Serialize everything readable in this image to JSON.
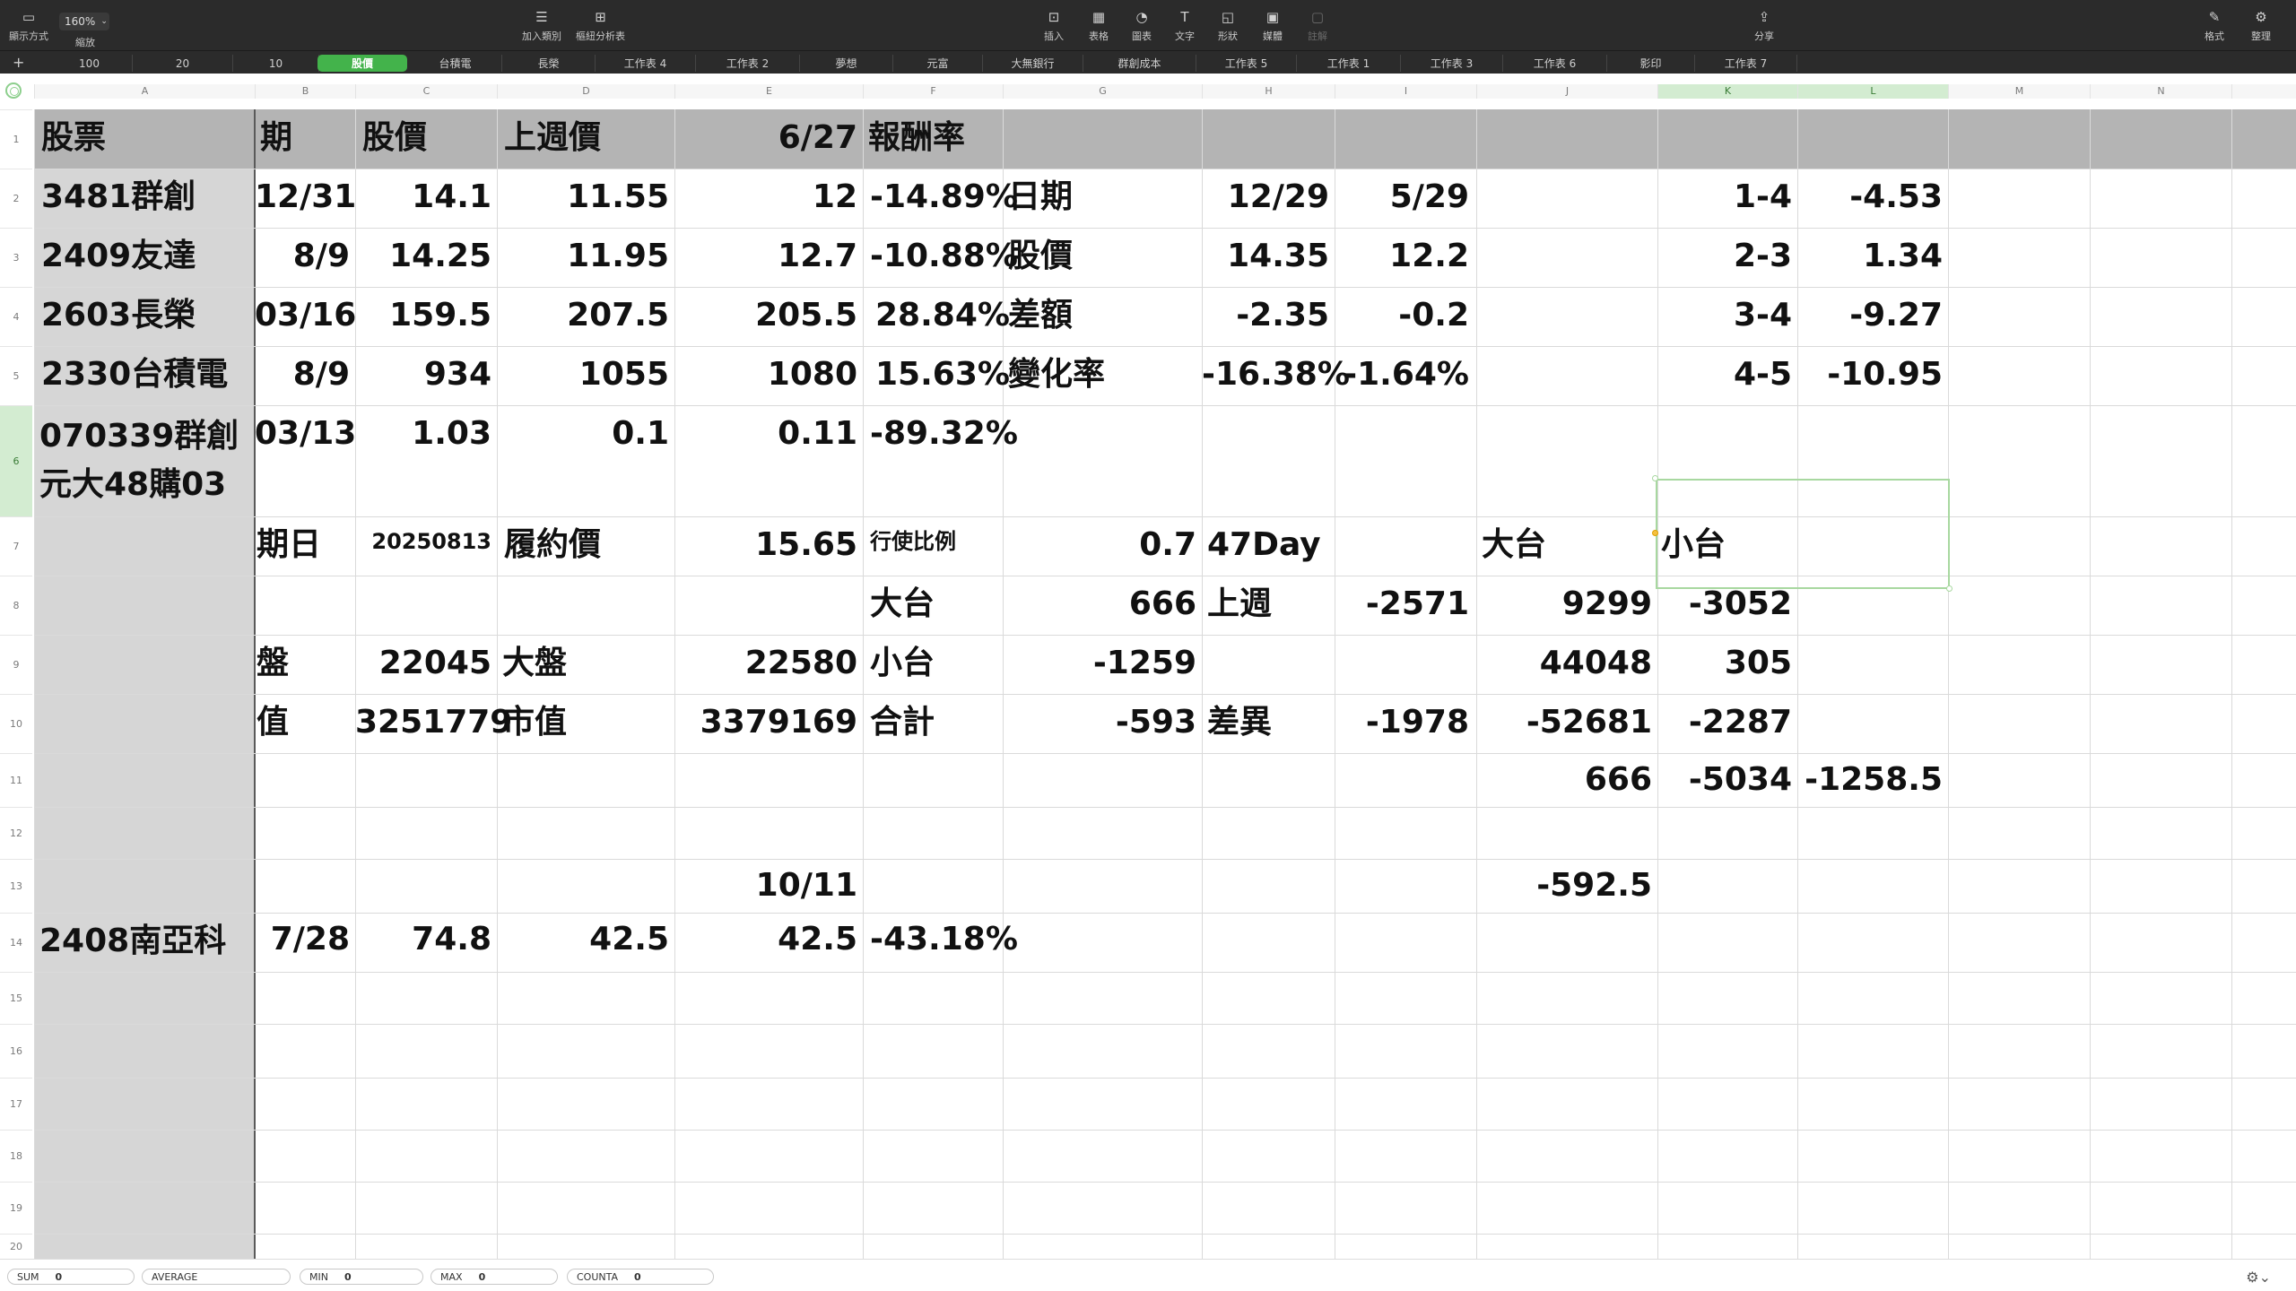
{
  "toolbar": {
    "view_label": "顯示方式",
    "zoom_value": "160%",
    "zoom_label": "縮放",
    "add_category": "加入類別",
    "pivot": "樞紐分析表",
    "insert": "插入",
    "table": "表格",
    "chart": "圖表",
    "text": "文字",
    "shape": "形狀",
    "media": "媒體",
    "comment": "註解",
    "share": "分享",
    "format": "格式",
    "organize": "整理"
  },
  "tabs": [
    "100",
    "20",
    "10",
    "股價",
    "台積電",
    "長榮",
    "工作表 4",
    "工作表 2",
    "夢想",
    "元富",
    "大無銀行",
    "群創成本",
    "工作表 5",
    "工作表 1",
    "工作表 3",
    "工作表 6",
    "影印",
    "工作表 7"
  ],
  "columns": [
    "A",
    "B",
    "C",
    "D",
    "E",
    "F",
    "G",
    "H",
    "I",
    "J",
    "K",
    "L",
    "M",
    "N"
  ],
  "rows": [
    "1",
    "2",
    "3",
    "4",
    "5",
    "6",
    "7",
    "8",
    "9",
    "10",
    "11",
    "12",
    "13",
    "14",
    "15",
    "16",
    "17",
    "18",
    "19",
    "20"
  ],
  "cells": {
    "r1": {
      "a": "股票",
      "b": "期",
      "c": "股價",
      "d": "上週價",
      "e": "6/27",
      "f": "報酬率"
    },
    "r2": {
      "a": "3481群創",
      "b": "12/31",
      "c": "14.1",
      "d": "11.55",
      "e": "12",
      "f": "-14.89%",
      "g": "日期",
      "h": "12/29",
      "i": "5/29",
      "k": "1-4",
      "l": "-4.53"
    },
    "r3": {
      "a": "2409友達",
      "b": "8/9",
      "c": "14.25",
      "d": "11.95",
      "e": "12.7",
      "f": "-10.88%",
      "g": "股價",
      "h": "14.35",
      "i": "12.2",
      "k": "2-3",
      "l": "1.34"
    },
    "r4": {
      "a": "2603長榮",
      "b": "03/16",
      "c": "159.5",
      "d": "207.5",
      "e": "205.5",
      "f": "28.84%",
      "g": "差額",
      "h": "-2.35",
      "i": "-0.2",
      "k": "3-4",
      "l": "-9.27"
    },
    "r5": {
      "a": "2330台積電",
      "b": "8/9",
      "c": "934",
      "d": "1055",
      "e": "1080",
      "f": "15.63%",
      "g": "變化率",
      "h": "-16.38%",
      "i": "-1.64%",
      "k": "4-5",
      "l": "-10.95"
    },
    "r6": {
      "a": "070339群創元大48購03",
      "b": "03/13",
      "c": "1.03",
      "d": "0.1",
      "e": "0.11",
      "f": "-89.32%"
    },
    "r7": {
      "b": "期日",
      "c": "20250813",
      "d": "履約價",
      "e": "15.65",
      "f": "行使比例",
      "g": "0.7",
      "h": "47Day",
      "j": "大台",
      "k": "小台"
    },
    "r8": {
      "f": "大台",
      "g": "666",
      "h": "上週",
      "i": "-2571",
      "j": "9299",
      "k": "-3052"
    },
    "r9": {
      "b": "盤",
      "c": "22045",
      "d": "大盤",
      "e": "22580",
      "f": "小台",
      "g": "-1259",
      "j": "44048",
      "k": "305"
    },
    "r10": {
      "b": "值",
      "c": "3251779",
      "d": "市值",
      "e": "3379169",
      "f": "合計",
      "g": "-593",
      "h": "差異",
      "i": "-1978",
      "j": "-52681",
      "k": "-2287"
    },
    "r11": {
      "j": "666",
      "k": "-5034",
      "l": "-1258.5"
    },
    "r13": {
      "e": "10/11",
      "j": "-592.5"
    },
    "r14": {
      "a": "2408南亞科",
      "b": "7/28",
      "c": "74.8",
      "d": "42.5",
      "e": "42.5",
      "f": "-43.18%"
    }
  },
  "status": {
    "sum_label": "SUM",
    "sum_value": "0",
    "avg_label": "AVERAGE",
    "avg_value": "",
    "min_label": "MIN",
    "min_value": "0",
    "max_label": "MAX",
    "max_value": "0",
    "counta_label": "COUNTA",
    "counta_value": "0"
  },
  "colors": {
    "accent": "#43b34b",
    "toolbar": "#2b2b2b",
    "header_band": "#b4b4b4",
    "col_a": "#d6d6d6"
  }
}
